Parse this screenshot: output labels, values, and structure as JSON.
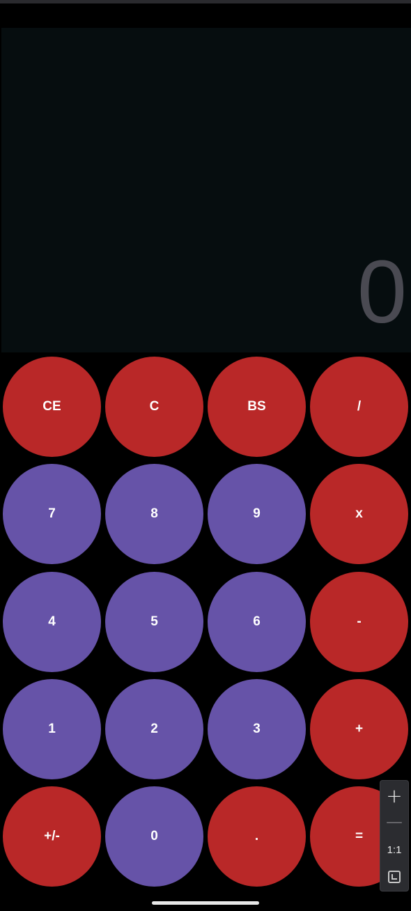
{
  "display": {
    "value": "0"
  },
  "keypad": {
    "rows": [
      [
        {
          "label": "CE",
          "name": "clear-entry-button",
          "color": "red"
        },
        {
          "label": "C",
          "name": "clear-button",
          "color": "red"
        },
        {
          "label": "BS",
          "name": "backspace-button",
          "color": "red"
        },
        {
          "label": "/",
          "name": "divide-button",
          "color": "red"
        }
      ],
      [
        {
          "label": "7",
          "name": "digit-7-button",
          "color": "purple"
        },
        {
          "label": "8",
          "name": "digit-8-button",
          "color": "purple"
        },
        {
          "label": "9",
          "name": "digit-9-button",
          "color": "purple"
        },
        {
          "label": "x",
          "name": "multiply-button",
          "color": "red"
        }
      ],
      [
        {
          "label": "4",
          "name": "digit-4-button",
          "color": "purple"
        },
        {
          "label": "5",
          "name": "digit-5-button",
          "color": "purple"
        },
        {
          "label": "6",
          "name": "digit-6-button",
          "color": "purple"
        },
        {
          "label": "-",
          "name": "subtract-button",
          "color": "red"
        }
      ],
      [
        {
          "label": "1",
          "name": "digit-1-button",
          "color": "purple"
        },
        {
          "label": "2",
          "name": "digit-2-button",
          "color": "purple"
        },
        {
          "label": "3",
          "name": "digit-3-button",
          "color": "purple"
        },
        {
          "label": "+",
          "name": "add-button",
          "color": "red"
        }
      ],
      [
        {
          "label": "+/-",
          "name": "negate-button",
          "color": "red"
        },
        {
          "label": "0",
          "name": "digit-0-button",
          "color": "purple"
        },
        {
          "label": ".",
          "name": "decimal-button",
          "color": "red"
        },
        {
          "label": "=",
          "name": "equals-button",
          "color": "red"
        }
      ]
    ]
  },
  "zoom_controls": {
    "plus_icon": "plus-icon",
    "minus_icon": "minus-icon",
    "ratio_label": "1:1",
    "fit_icon": "fit-to-screen-icon"
  },
  "colors": {
    "operator": "#b92828",
    "digit": "#6653a8",
    "display_bg": "#060d0f",
    "display_text": "#4a4a52"
  }
}
